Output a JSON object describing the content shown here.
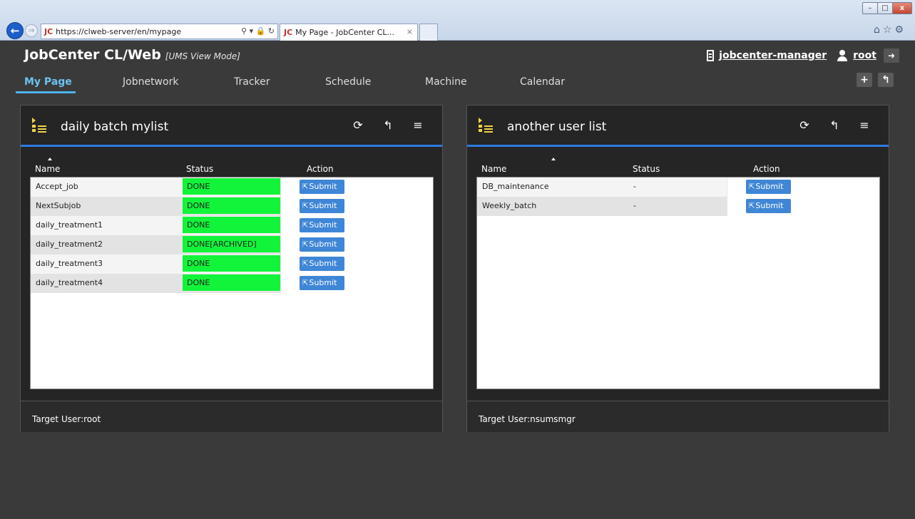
{
  "browser": {
    "url": "https://clweb-server/en/mypage",
    "tab_title": "My Page - JobCenter CL...",
    "jc_logo": "JC",
    "tab_close": "×",
    "win_minimize": "–",
    "win_maximize": "□",
    "win_close": "x"
  },
  "app": {
    "title": "JobCenter CL/Web",
    "mode": "[UMS View Mode]",
    "server_link": "jobcenter-manager",
    "user_link": "root"
  },
  "menu": [
    {
      "label": "My Page",
      "active": true
    },
    {
      "label": "Jobnetwork"
    },
    {
      "label": "Tracker"
    },
    {
      "label": "Schedule"
    },
    {
      "label": "Machine"
    },
    {
      "label": "Calendar"
    }
  ],
  "columns": {
    "name": "Name",
    "status": "Status",
    "action": "Action"
  },
  "submit_label": "Submit",
  "panels": [
    {
      "title": "daily batch mylist",
      "footer": "Target User:root",
      "rows": [
        {
          "name": "Accept_job",
          "status": "DONE"
        },
        {
          "name": "NextSubjob",
          "status": "DONE"
        },
        {
          "name": "daily_treatment1",
          "status": "DONE"
        },
        {
          "name": "daily_treatment2",
          "status": "DONE[ARCHIVED]"
        },
        {
          "name": "daily_treatment3",
          "status": "DONE"
        },
        {
          "name": "daily_treatment4",
          "status": "DONE"
        }
      ]
    },
    {
      "title": "another user list",
      "footer": "Target User:nsumsmgr",
      "rows": [
        {
          "name": "DB_maintenance",
          "status": "-"
        },
        {
          "name": "Weekly_batch",
          "status": "-"
        }
      ]
    }
  ],
  "colors": {
    "done_status": "#12f43a",
    "submit_button": "#3f86d6",
    "active_menu": "#6cc3f0",
    "panel_accent": "#2e7be0",
    "list_icon": "#f1d34a"
  },
  "icons": {
    "back": "back-arrow-icon",
    "forward": "forward-arrow-icon",
    "server": "server-icon",
    "user": "user-icon",
    "logout": "logout-icon",
    "add": "plus-icon",
    "settings": "wrench-icon",
    "refresh": "refresh-icon",
    "menu": "hamburger-icon",
    "list": "list-icon",
    "submit": "submit-icon"
  }
}
